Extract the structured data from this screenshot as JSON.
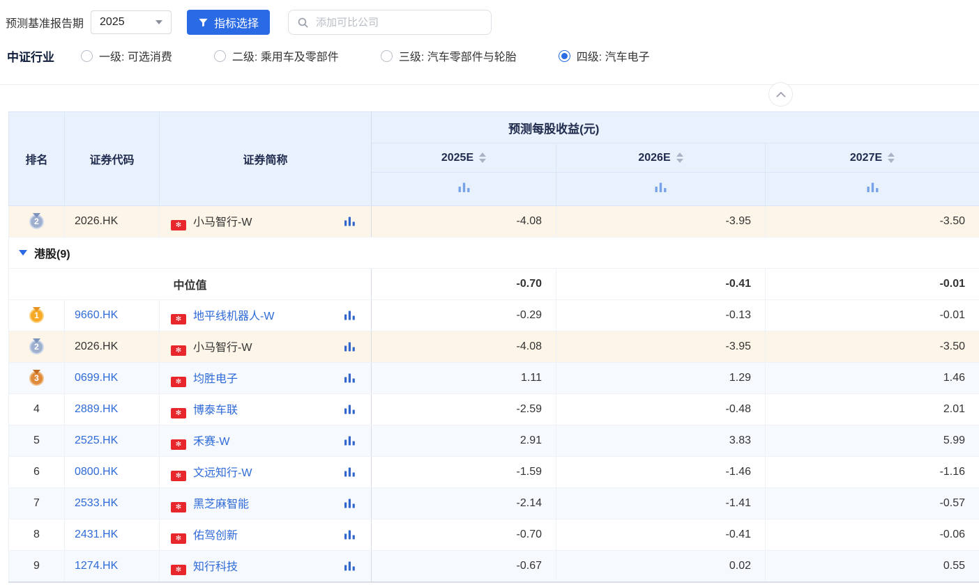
{
  "toolbar": {
    "report_period_label": "预测基准报告期",
    "period_value": "2025",
    "indicator_button": "指标选择",
    "search_placeholder": "添加可比公司"
  },
  "industry": {
    "label": "中证行业",
    "options": [
      {
        "label": "一级: 可选消费",
        "selected": false
      },
      {
        "label": "二级: 乘用车及零部件",
        "selected": false
      },
      {
        "label": "三级: 汽车零部件与轮胎",
        "selected": false
      },
      {
        "label": "四级: 汽车电子",
        "selected": true
      }
    ]
  },
  "table": {
    "group_header": "预测每股收益(元)",
    "columns": [
      "排名",
      "证券代码",
      "证券简称"
    ],
    "year_columns": [
      "2025E",
      "2026E",
      "2027E"
    ],
    "pinned_row": {
      "rank": "2",
      "medal": "silver",
      "code": "2026.HK",
      "code_link": false,
      "name": "小马智行-W",
      "name_link": false,
      "values": [
        "-4.08",
        "-3.95",
        "-3.50"
      ],
      "highlight": true
    },
    "group_row": {
      "label": "港股(9)",
      "expanded": true
    },
    "median": {
      "label": "中位值",
      "values": [
        "-0.70",
        "-0.41",
        "-0.01"
      ]
    },
    "rows": [
      {
        "rank": "1",
        "medal": "gold",
        "code": "9660.HK",
        "code_link": true,
        "name": "地平线机器人-W",
        "name_link": true,
        "values": [
          "-0.29",
          "-0.13",
          "-0.01"
        ],
        "highlight": false
      },
      {
        "rank": "2",
        "medal": "silver",
        "code": "2026.HK",
        "code_link": false,
        "name": "小马智行-W",
        "name_link": false,
        "values": [
          "-4.08",
          "-3.95",
          "-3.50"
        ],
        "highlight": true
      },
      {
        "rank": "3",
        "medal": "bronze",
        "code": "0699.HK",
        "code_link": true,
        "name": "均胜电子",
        "name_link": true,
        "values": [
          "1.11",
          "1.29",
          "1.46"
        ],
        "highlight": false
      },
      {
        "rank": "4",
        "medal": null,
        "code": "2889.HK",
        "code_link": true,
        "name": "博泰车联",
        "name_link": true,
        "values": [
          "-2.59",
          "-0.48",
          "2.01"
        ],
        "highlight": false
      },
      {
        "rank": "5",
        "medal": null,
        "code": "2525.HK",
        "code_link": true,
        "name": "禾赛-W",
        "name_link": true,
        "values": [
          "2.91",
          "3.83",
          "5.99"
        ],
        "highlight": false
      },
      {
        "rank": "6",
        "medal": null,
        "code": "0800.HK",
        "code_link": true,
        "name": "文远知行-W",
        "name_link": true,
        "values": [
          "-1.59",
          "-1.46",
          "-1.16"
        ],
        "highlight": false
      },
      {
        "rank": "7",
        "medal": null,
        "code": "2533.HK",
        "code_link": true,
        "name": "黑芝麻智能",
        "name_link": true,
        "values": [
          "-2.14",
          "-1.41",
          "-0.57"
        ],
        "highlight": false
      },
      {
        "rank": "8",
        "medal": null,
        "code": "2431.HK",
        "code_link": true,
        "name": "佑驾创新",
        "name_link": true,
        "values": [
          "-0.70",
          "-0.41",
          "-0.06"
        ],
        "highlight": false
      },
      {
        "rank": "9",
        "medal": null,
        "code": "1274.HK",
        "code_link": true,
        "name": "知行科技",
        "name_link": true,
        "values": [
          "-0.67",
          "0.02",
          "0.55"
        ],
        "highlight": false
      }
    ]
  },
  "icons": {
    "filter": "filter-icon",
    "search": "search-icon",
    "collapse": "chevron-up-icon",
    "flag": "hk-flag-icon",
    "chart": "column-chart-icon"
  },
  "colors": {
    "accent": "#2a6ae4",
    "link": "#2f6bd8",
    "header_bg": "#e9f1fc",
    "highlight_row": "#fdf6e8",
    "stripe_row": "#f6f9fd",
    "flag_red": "#e8272d",
    "medal_gold": "#f7a928",
    "medal_silver": "#9fb0cf",
    "medal_bronze": "#e08a3c"
  }
}
